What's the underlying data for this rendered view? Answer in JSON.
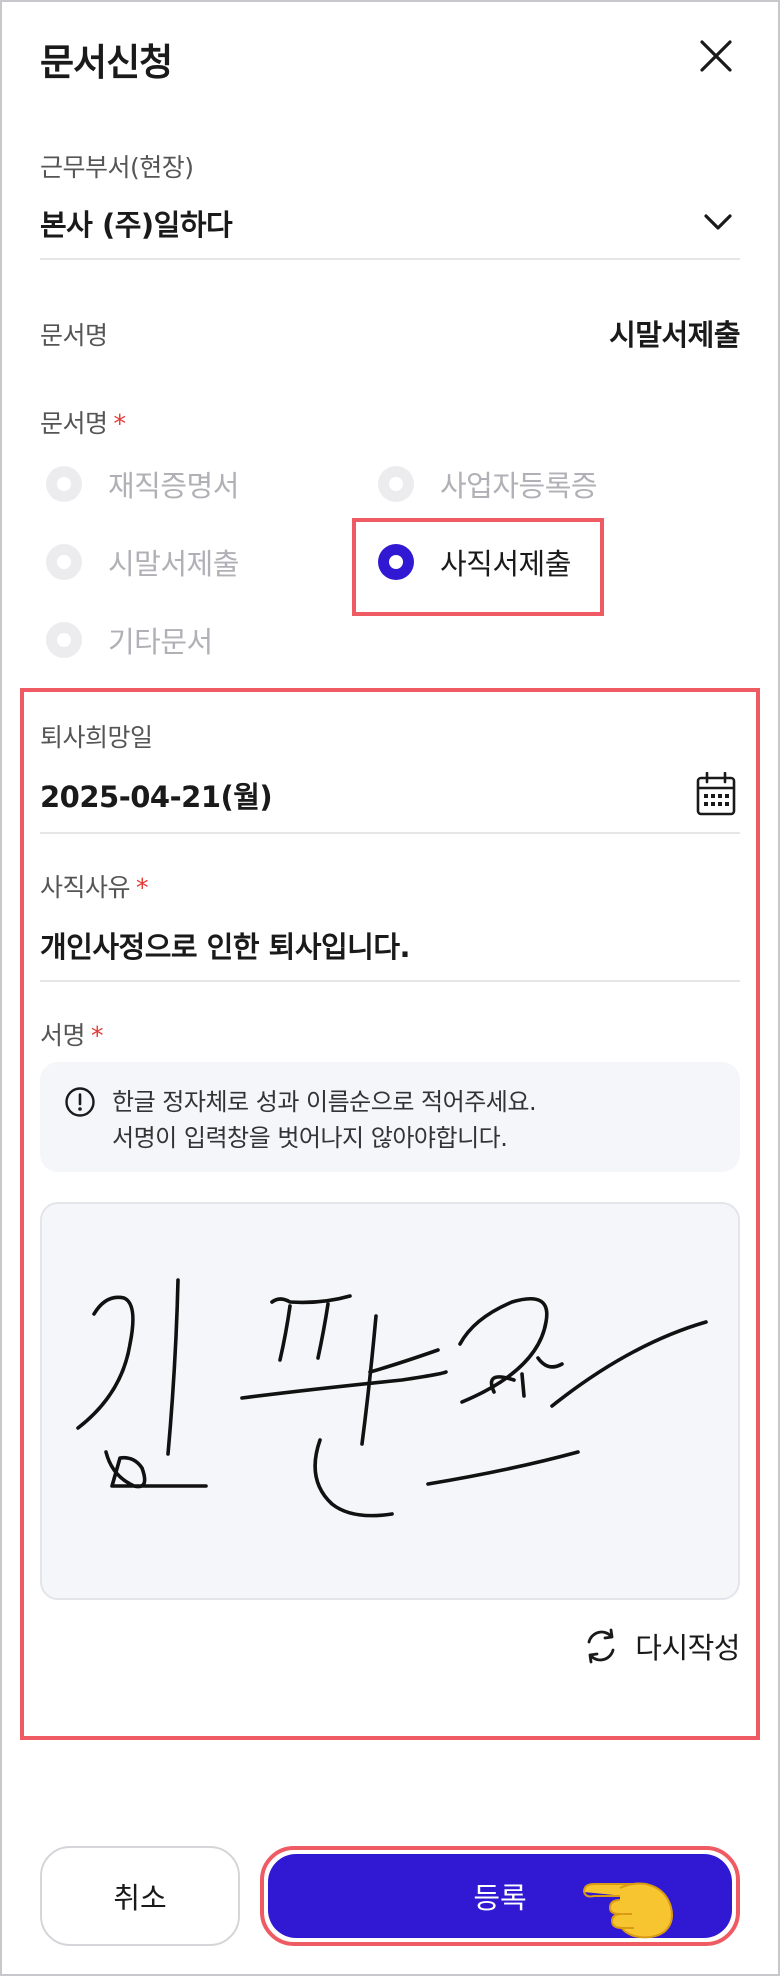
{
  "header": {
    "title": "문서신청"
  },
  "department": {
    "label": "근무부서(현장)",
    "value": "본사 (주)일하다"
  },
  "doc_summary": {
    "label": "문서명",
    "value": "시말서제출"
  },
  "doc_type": {
    "label": "문서명",
    "required_mark": "*",
    "options": [
      {
        "label": "재직증명서",
        "checked": false
      },
      {
        "label": "사업자등록증",
        "checked": false
      },
      {
        "label": "시말서제출",
        "checked": false
      },
      {
        "label": "사직서제출",
        "checked": true
      },
      {
        "label": "기타문서",
        "checked": false
      }
    ]
  },
  "resignation_date": {
    "label": "퇴사희망일",
    "value": "2025-04-21(월)"
  },
  "reason": {
    "label": "사직사유",
    "required_mark": "*",
    "value": "개인사정으로 인한 퇴사입니다."
  },
  "signature": {
    "label": "서명",
    "required_mark": "*",
    "hint_line1": "한글 정자체로 성과 이름순으로 적어주세요.",
    "hint_line2": "서명이 입력창을 벗어나지 않아야합니다.",
    "redo_label": "다시작성",
    "signed_name": "김판교"
  },
  "footer": {
    "cancel_label": "취소",
    "submit_label": "등록"
  },
  "colors": {
    "accent": "#3119d3",
    "highlight": "#ef5b62",
    "required": "#e53935"
  }
}
